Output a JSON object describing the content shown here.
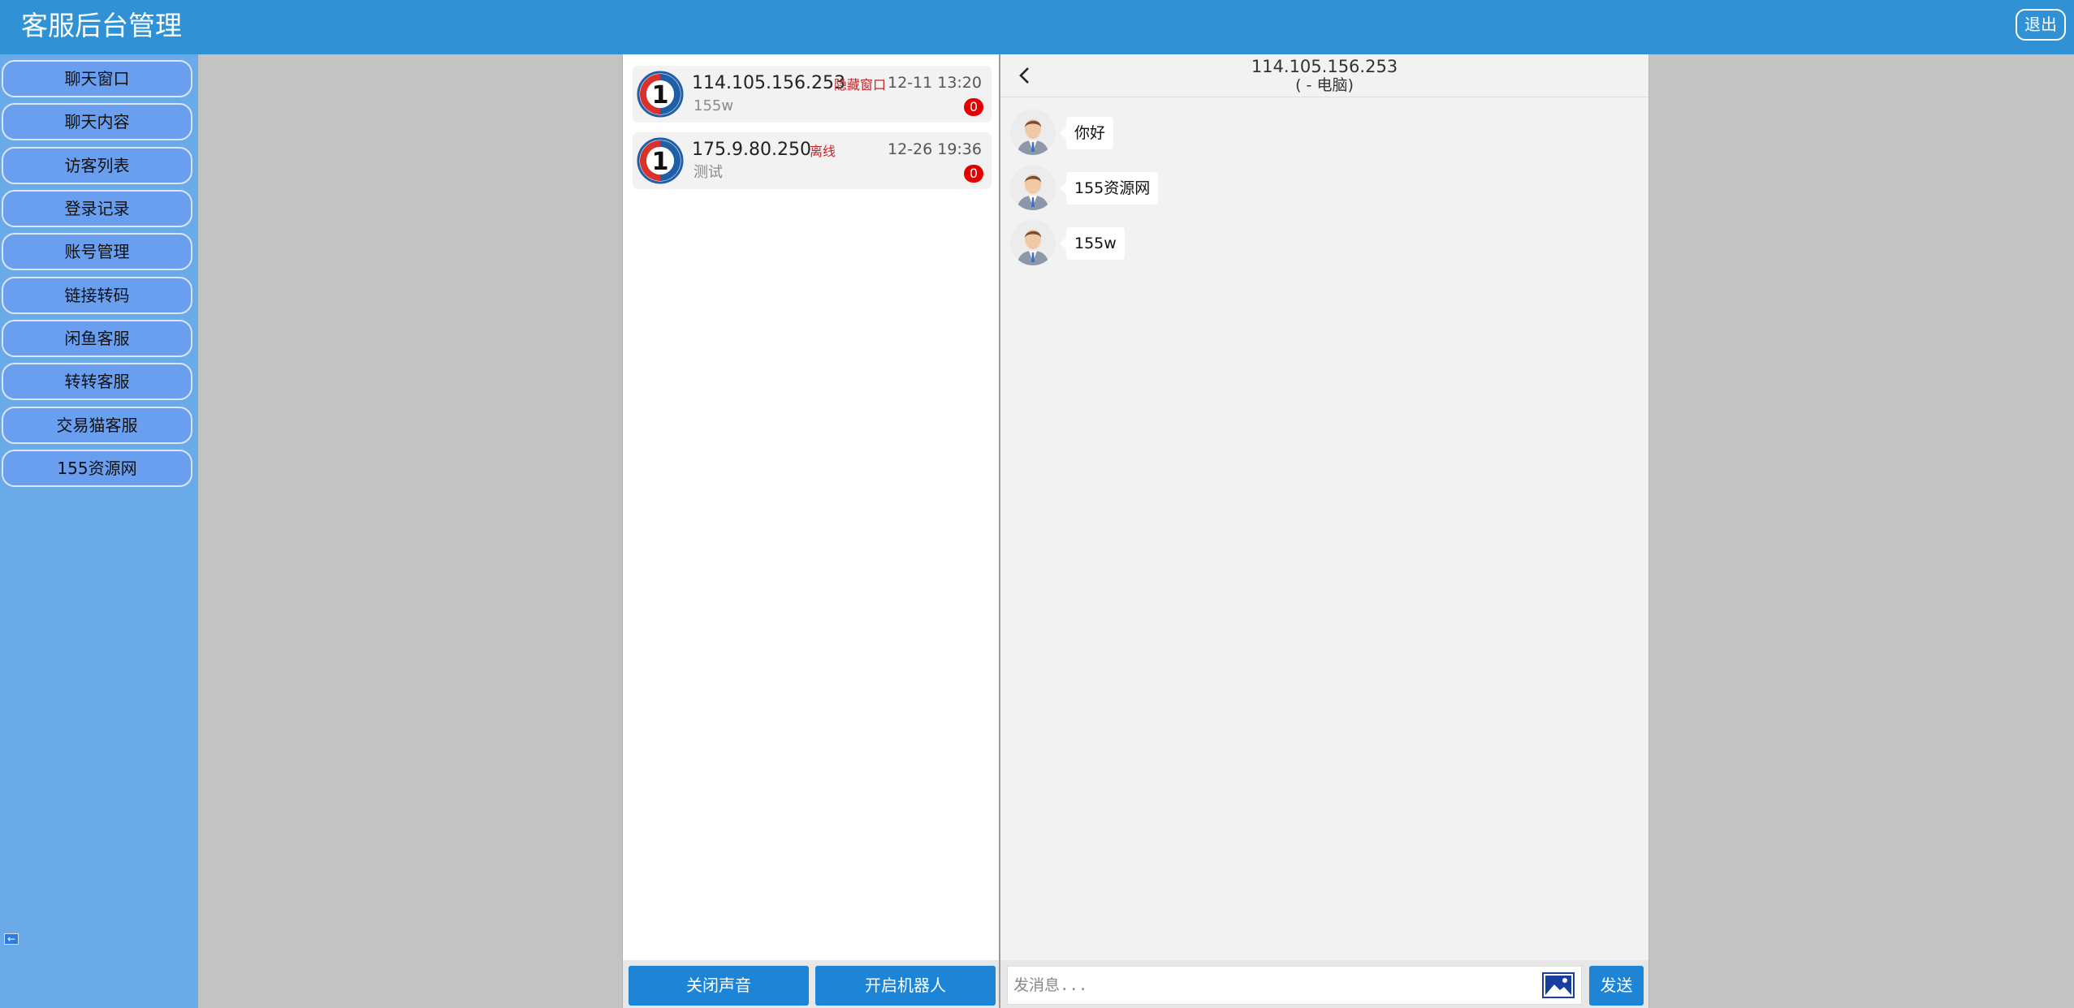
{
  "header": {
    "title": "客服后台管理",
    "logout_label": "退出"
  },
  "sidebar": {
    "items": [
      {
        "label": "聊天窗口"
      },
      {
        "label": "聊天内容"
      },
      {
        "label": "访客列表"
      },
      {
        "label": "登录记录"
      },
      {
        "label": "账号管理"
      },
      {
        "label": "链接转码"
      },
      {
        "label": "闲鱼客服"
      },
      {
        "label": "转转客服"
      },
      {
        "label": "交易猫客服"
      },
      {
        "label": "155资源网"
      }
    ],
    "collapse_icon": "arrow-left-icon"
  },
  "conversations": [
    {
      "ip": "114.105.156.253",
      "tag": "隐藏窗口",
      "preview": "155w",
      "time": "12-11 13:20",
      "unread": "0"
    },
    {
      "ip": "175.9.80.250",
      "tag": "离线",
      "preview": "测试",
      "time": "12-26 19:36",
      "unread": "0"
    }
  ],
  "conv_footer": {
    "mute_label": "关闭声音",
    "robot_label": "开启机器人"
  },
  "chat": {
    "title": "114.105.156.253",
    "subtitle": "( - 电脑)",
    "messages": [
      {
        "text": "你好"
      },
      {
        "text": "155资源网"
      },
      {
        "text": "155w"
      }
    ],
    "input_placeholder": "发消息...",
    "send_label": "发送"
  },
  "colors": {
    "header_bg": "#3092d5",
    "sidebar_bg": "#6aaae9",
    "nav_button_bg": "#6a9eef",
    "primary_button": "#1e84d6",
    "badge_red": "#e40000",
    "tag_red": "#c0262b"
  }
}
